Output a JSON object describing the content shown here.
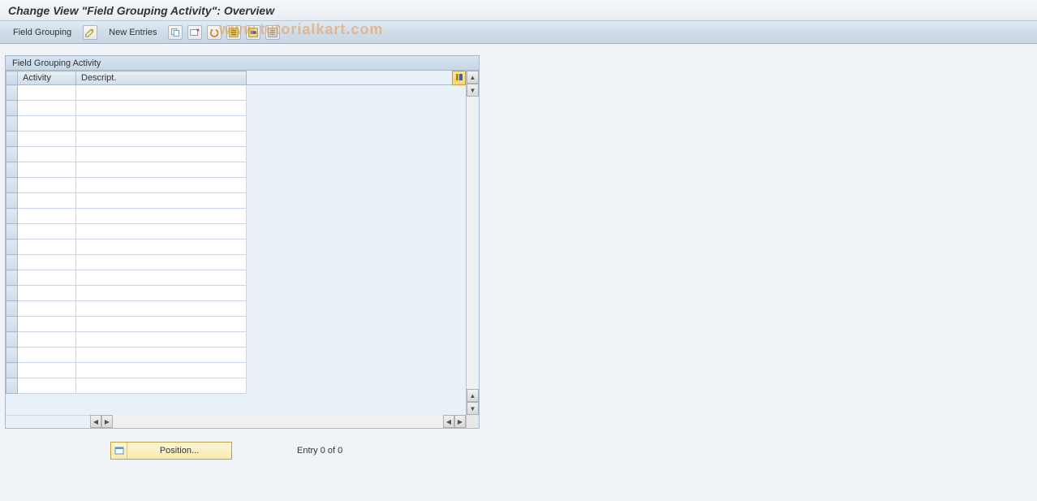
{
  "title": "Change View \"Field Grouping Activity\": Overview",
  "toolbar": {
    "field_grouping": "Field Grouping",
    "new_entries": "New Entries",
    "icons": [
      "copy",
      "delete",
      "undo",
      "select-all",
      "select-block",
      "deselect-all"
    ]
  },
  "watermark": "www.tutorialkart.com",
  "panel": {
    "title": "Field Grouping Activity",
    "columns": {
      "activity": "Activity",
      "description": "Descript."
    },
    "rows": [
      {
        "activity": "",
        "description": ""
      },
      {
        "activity": "",
        "description": ""
      },
      {
        "activity": "",
        "description": ""
      },
      {
        "activity": "",
        "description": ""
      },
      {
        "activity": "",
        "description": ""
      },
      {
        "activity": "",
        "description": ""
      },
      {
        "activity": "",
        "description": ""
      },
      {
        "activity": "",
        "description": ""
      },
      {
        "activity": "",
        "description": ""
      },
      {
        "activity": "",
        "description": ""
      },
      {
        "activity": "",
        "description": ""
      },
      {
        "activity": "",
        "description": ""
      },
      {
        "activity": "",
        "description": ""
      },
      {
        "activity": "",
        "description": ""
      },
      {
        "activity": "",
        "description": ""
      },
      {
        "activity": "",
        "description": ""
      },
      {
        "activity": "",
        "description": ""
      },
      {
        "activity": "",
        "description": ""
      },
      {
        "activity": "",
        "description": ""
      },
      {
        "activity": "",
        "description": ""
      }
    ]
  },
  "footer": {
    "position_label": "Position...",
    "entry_status": "Entry 0 of 0"
  }
}
